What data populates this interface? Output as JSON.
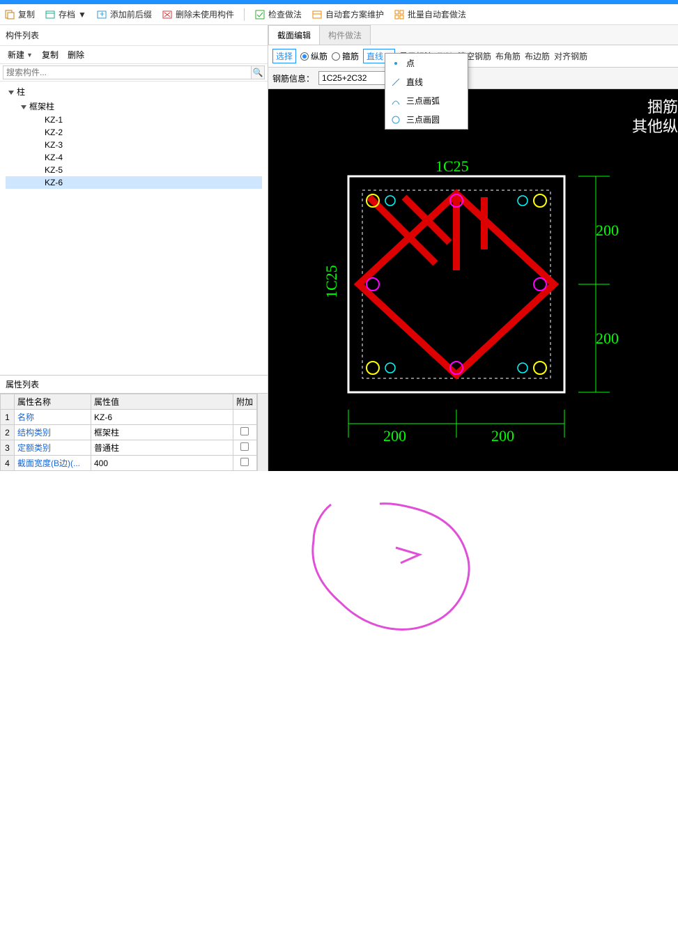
{
  "toolbar": {
    "copy": "复制",
    "archive": "存档",
    "addPrefix": "添加前后缀",
    "deleteUnused": "删除未使用构件",
    "checkMethod": "检查做法",
    "autoSchemeMaintain": "自动套方案维护",
    "batchAutoMethod": "批量自动套做法"
  },
  "leftPanel": {
    "title": "构件列表",
    "new": "新建",
    "copy": "复制",
    "delete": "删除",
    "searchPlaceholder": "搜索构件...",
    "tree": {
      "root": "柱",
      "group": "框架柱",
      "items": [
        "KZ-1",
        "KZ-2",
        "KZ-3",
        "KZ-4",
        "KZ-5",
        "KZ-6"
      ],
      "selectedIndex": 5
    }
  },
  "props": {
    "title": "属性列表",
    "cols": {
      "name": "属性名称",
      "value": "属性值",
      "attach": "附加"
    },
    "rows": [
      {
        "n": "1",
        "name": "名称",
        "value": "KZ-6",
        "attach": null
      },
      {
        "n": "2",
        "name": "结构类别",
        "value": "框架柱",
        "attach": false
      },
      {
        "n": "3",
        "name": "定额类别",
        "value": "普通柱",
        "attach": false
      },
      {
        "n": "4",
        "name": "截面宽度(B边)(...",
        "value": "400",
        "attach": false
      }
    ]
  },
  "rightTabs": {
    "active": "截面编辑",
    "inactive": "构件做法"
  },
  "rtoolbar": {
    "select": "选择",
    "radio1": "纵筋",
    "radio2": "箍筋",
    "lineDD": "直线",
    "showMark": "显示标注",
    "delete": "删除",
    "clearRebar": "清空钢筋",
    "cornerRebar": "布角筋",
    "edgeRebar": "布边筋",
    "alignRebar": "对齐钢筋"
  },
  "dropdown": {
    "items": [
      "点",
      "直线",
      "三点画弧",
      "三点画圆"
    ]
  },
  "rebarInfo": {
    "label": "钢筋信息：",
    "value": "1C25+2C32"
  },
  "canvas": {
    "topLabel": "1C25",
    "leftLabel": "1C25",
    "dimH1": "200",
    "dimH2": "200",
    "dimV1": "200",
    "dimV2": "200",
    "sideText1": "捆筋",
    "sideText2": "其他纵"
  }
}
